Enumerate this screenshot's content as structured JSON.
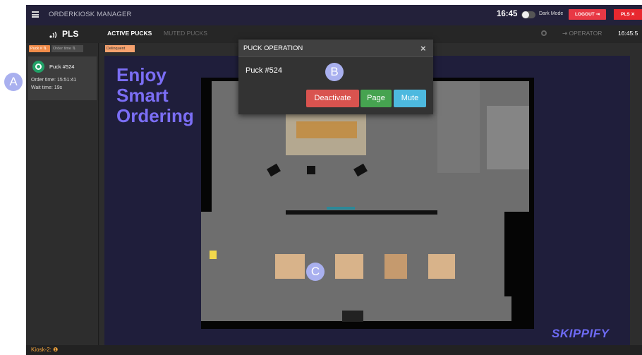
{
  "topbar": {
    "title": "ORDERKIOSK MANAGER",
    "clock": "16:45",
    "dark_mode_label": "Dark Mode",
    "logout_label": "LOGOUT",
    "pls_label": "PLS"
  },
  "subbar": {
    "logo": "PLS",
    "tabs": [
      {
        "label": "ACTIVE PUCKS",
        "active": true
      },
      {
        "label": "MUTED PUCKS",
        "active": false
      }
    ],
    "operator_label": "OPERATOR",
    "time": "16:45:5"
  },
  "sidebar": {
    "sort_chips": [
      "Puck #",
      "Order time"
    ],
    "puck_card": {
      "name": "Puck #524",
      "order_time": "Order time: 15:51:41",
      "wait_time": "Wait time:  19s"
    }
  },
  "map": {
    "filter_chip": "Delinquent",
    "headline": "Enjoy Smart Ordering",
    "brand": "SKIPPIFY"
  },
  "footer": {
    "kiosk_label": "Kiosk-2:"
  },
  "modal": {
    "title": "PUCK OPERATION",
    "puck": "Puck #524",
    "buttons": {
      "deactivate": "Deactivate",
      "page": "Page",
      "mute": "Mute"
    }
  },
  "markers": [
    "A",
    "B",
    "C"
  ],
  "colors": {
    "topbar": "#23213a",
    "logout": "#e83845",
    "deactivate": "#d9534f",
    "page": "#46a350",
    "mute": "#4db9df",
    "headline": "#7b6ef5",
    "marker": "#a9b0ef"
  }
}
